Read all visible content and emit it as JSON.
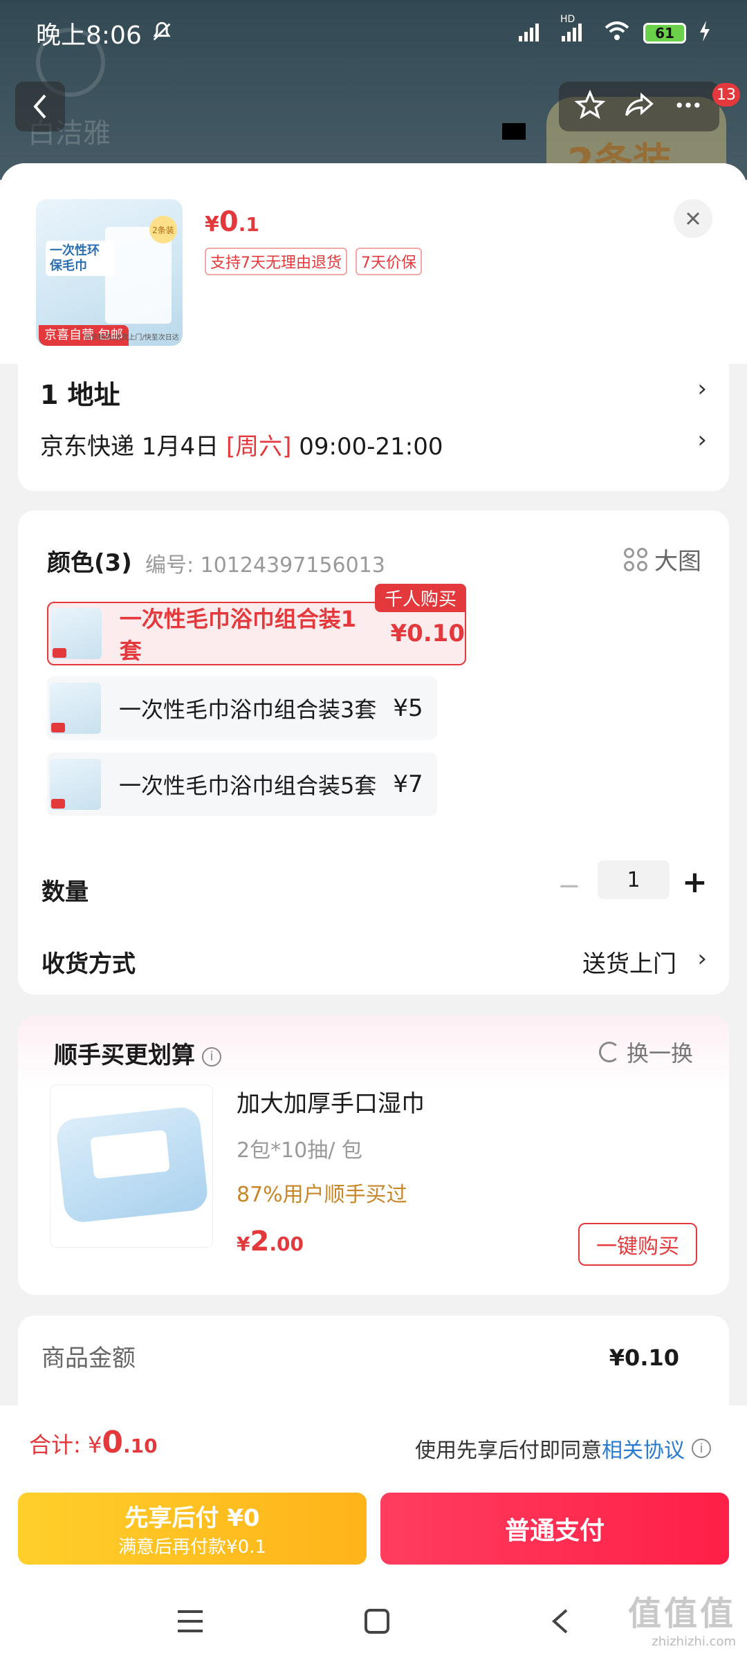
{
  "status_bar": {
    "time": "晚上8:06",
    "battery": "61",
    "network": "HD"
  },
  "background": {
    "brand": "白洁雅",
    "pack_text": "2条装",
    "cart_badge": "13"
  },
  "product": {
    "price_yen": "¥",
    "price_int": "0",
    "price_dec": ".1",
    "tags": [
      "支持7天无理由退货",
      "7天价保"
    ],
    "thumb_title": "一次性环保毛巾",
    "thumb_tag": "京喜自营 包邮",
    "thumb_pack": "2条装",
    "thumb_footer": "京东物流/送货上门/快至次日达"
  },
  "address": {
    "line1": "1  地址",
    "courier": "京东快递 1月4日 ",
    "weekday": "[周六]",
    "time_window": " 09:00-21:00"
  },
  "spec": {
    "title": "颜色(3)",
    "code": "编号: 10124397156013",
    "big_image": "大图",
    "options": [
      {
        "name": "一次性毛巾浴巾组合装1套",
        "price": "¥0.10",
        "flag": "千人购买",
        "selected": true
      },
      {
        "name": "一次性毛巾浴巾组合装3套",
        "price": "¥5",
        "selected": false
      },
      {
        "name": "一次性毛巾浴巾组合装5套",
        "price": "¥7",
        "selected": false
      }
    ],
    "qty_label": "数量",
    "qty_minus": "−",
    "qty_value": "1",
    "qty_plus": "+",
    "ship_label": "收货方式",
    "ship_value": "送货上门"
  },
  "extra": {
    "title": "顺手买更划算",
    "refresh": "换一换",
    "item_name": "加大加厚手口湿巾",
    "item_spec": "2包*10抽/ 包",
    "item_pct": "87%用户顺手买过",
    "price_yen": "¥",
    "price_int": "2",
    "price_dec": ".00",
    "buy_label": "一键购买"
  },
  "summary": {
    "label": "商品金额",
    "value": "¥0.10"
  },
  "bottom": {
    "total_label": "合计: ",
    "total_yen": "¥",
    "total_int": "0",
    "total_dec": ".10",
    "agree_prefix": "使用先享后付即同意",
    "agree_link": "相关协议",
    "later_line1": "先享后付 ¥0",
    "later_line2": "满意后再付款¥0.1",
    "pay_label": "普通支付"
  },
  "watermark": {
    "mark": "值值值",
    "site": "zhizhizhi.com"
  },
  "colors": {
    "accent_red": "#e4393c",
    "pay_red": "#ff1f47",
    "later_yellow": "#ffb31a",
    "link_blue": "#2a7ad0"
  }
}
